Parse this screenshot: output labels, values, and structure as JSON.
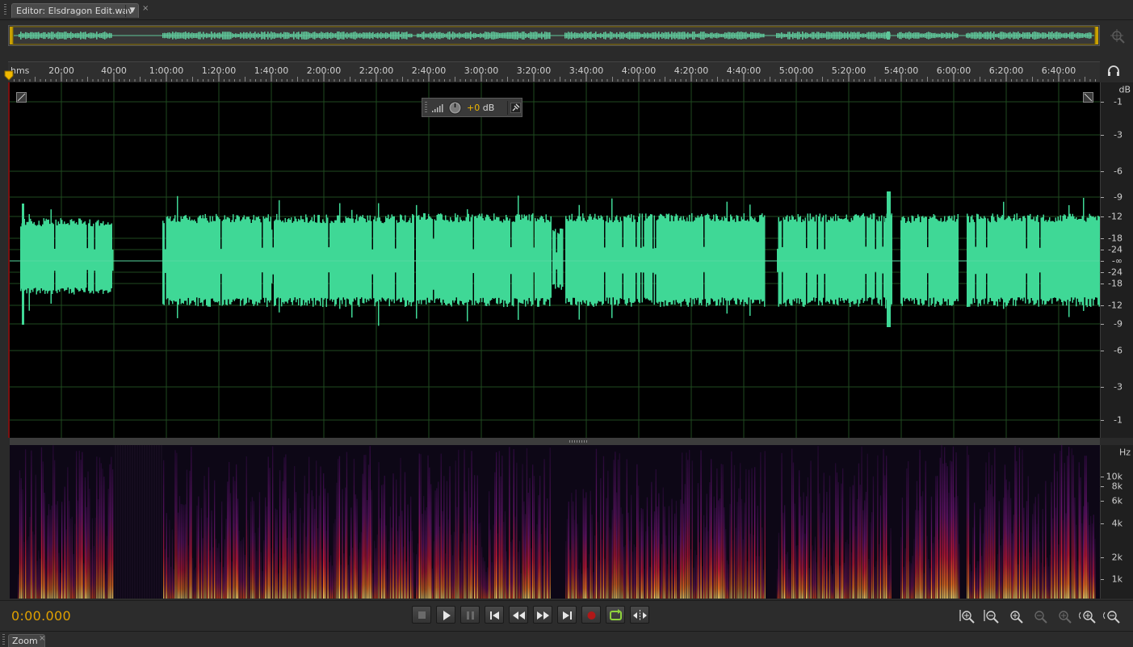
{
  "tab": {
    "label": "Editor: Elsdragon Edit.wav",
    "menu_glyph": "▼",
    "close_glyph": "×"
  },
  "ruler": {
    "unit_label": "hms",
    "ticks": [
      "20:00",
      "40:00",
      "1:00:00",
      "1:20:00",
      "1:40:00",
      "2:00:00",
      "2:20:00",
      "2:40:00",
      "3:00:00",
      "3:20:00",
      "3:40:00",
      "4:00:00",
      "4:20:00",
      "4:40:00",
      "5:00:00",
      "5:20:00",
      "5:40:00",
      "6:00:00",
      "6:20:00",
      "6:40:00"
    ]
  },
  "amplitude_scale": {
    "unit": "dB",
    "upper": [
      "-1",
      "-3",
      "-6",
      "-9",
      "-12",
      "-18",
      "-24"
    ],
    "center": "-∞",
    "lower": [
      "-24",
      "-18",
      "-12",
      "-9",
      "-6",
      "-3",
      "-1"
    ]
  },
  "frequency_scale": {
    "unit": "Hz",
    "labels": [
      "10k",
      "8k",
      "6k",
      "4k",
      "2k",
      "1k"
    ]
  },
  "hud": {
    "value": "+0",
    "unit": "dB"
  },
  "transport": {
    "timecode": "0:00.000",
    "buttons": [
      "stop-icon",
      "play-icon",
      "pause-icon",
      "go-to-start-icon",
      "rewind-icon",
      "fast-forward-icon",
      "go-to-end-icon",
      "record-icon",
      "loop-icon",
      "skip-selection-icon"
    ]
  },
  "zoom_controls": [
    "zoom-in-amplitude-icon",
    "zoom-out-amplitude-icon",
    "zoom-in-time-icon",
    "zoom-out-full-icon",
    "zoom-selection-icon",
    "zoom-in-point-icon",
    "zoom-out-point-icon"
  ],
  "bottom_panel": {
    "label": "Zoom",
    "close_glyph": "×"
  },
  "colors": {
    "waveform": "#3fd896",
    "timecode": "#e1a100",
    "playhead": "#f0b800",
    "grid": "#1f4a1f"
  }
}
